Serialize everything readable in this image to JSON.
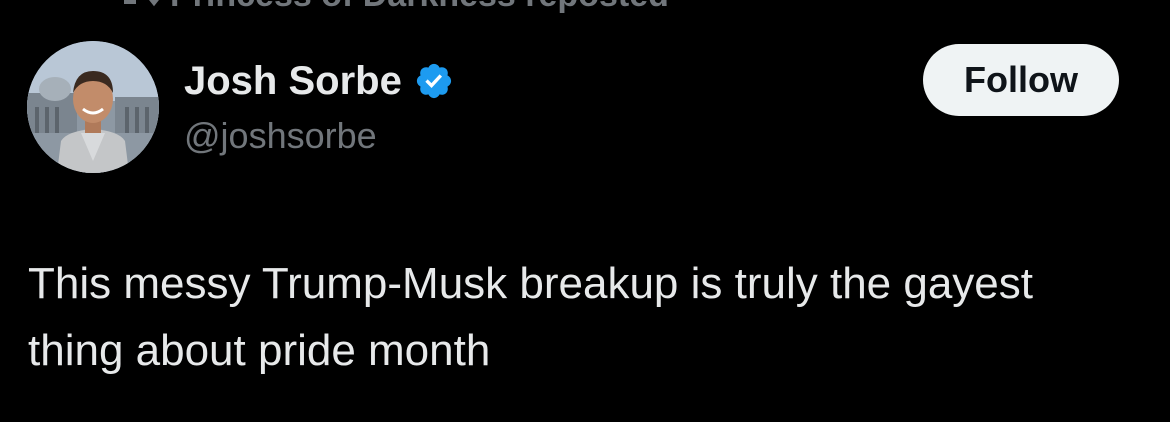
{
  "repost": {
    "text": "Princess of Darkness reposted",
    "icon": "repost-icon"
  },
  "author": {
    "display_name": "Josh Sorbe",
    "handle": "@joshsorbe",
    "verified": true,
    "verified_color": "#1d9bf0",
    "avatar_icon": "avatar"
  },
  "follow_button": {
    "label": "Follow"
  },
  "tweet": {
    "text": "This messy Trump-Musk breakup is truly the gayest thing about pride month"
  },
  "colors": {
    "background": "#000000",
    "primary_text": "#e7e9ea",
    "secondary_text": "#71767b",
    "button_bg": "#eff3f4",
    "button_text": "#0f1419"
  }
}
